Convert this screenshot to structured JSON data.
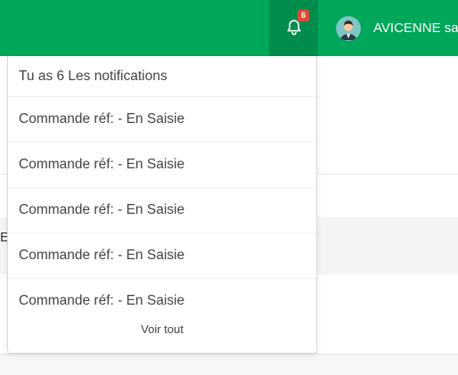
{
  "header": {
    "notification_count": "6",
    "user_name": "AVICENNE sa"
  },
  "background": {
    "partial_letter": "E"
  },
  "notifications": {
    "header": "Tu as 6 Les notifications",
    "items": [
      {
        "label": "Commande réf: - En Saisie"
      },
      {
        "label": "Commande réf: - En Saisie"
      },
      {
        "label": "Commande réf: - En Saisie"
      },
      {
        "label": "Commande réf: - En Saisie"
      },
      {
        "label": "Commande réf: - En Saisie"
      }
    ],
    "footer": "Voir tout"
  },
  "colors": {
    "topbar": "#00a65a",
    "bell_active": "#008d4c",
    "badge": "#dd4b39"
  }
}
